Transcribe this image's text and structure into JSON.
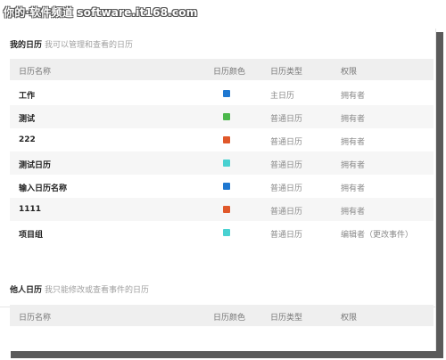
{
  "watermark": "你的·软件频道 software.it168.com",
  "my_calendars": {
    "title": "我的日历",
    "subtitle": "我可以管理和查看的日历",
    "headers": {
      "name": "日历名称",
      "color": "日历颜色",
      "type": "日历类型",
      "permission": "权限"
    },
    "rows": [
      {
        "name": "工作",
        "color": "#1f78d1",
        "type": "主日历",
        "permission": "拥有者"
      },
      {
        "name": "测试",
        "color": "#4cb84c",
        "type": "普通日历",
        "permission": "拥有者"
      },
      {
        "name": "222",
        "color": "#e0582a",
        "type": "普通日历",
        "permission": "拥有者"
      },
      {
        "name": "测试日历",
        "color": "#49d1d1",
        "type": "普通日历",
        "permission": "拥有者"
      },
      {
        "name": "输入日历名称",
        "color": "#1f78d1",
        "type": "普通日历",
        "permission": "拥有者"
      },
      {
        "name": "1111",
        "color": "#e0582a",
        "type": "普通日历",
        "permission": "拥有者"
      },
      {
        "name": "项目组",
        "color": "#49d1d1",
        "type": "普通日历",
        "permission": "编辑者（更改事件）"
      }
    ]
  },
  "others_calendars": {
    "title": "他人日历",
    "subtitle": "我只能修改或查看事件的日历",
    "headers": {
      "name": "日历名称",
      "color": "日历颜色",
      "type": "日历类型",
      "permission": "权限"
    }
  }
}
